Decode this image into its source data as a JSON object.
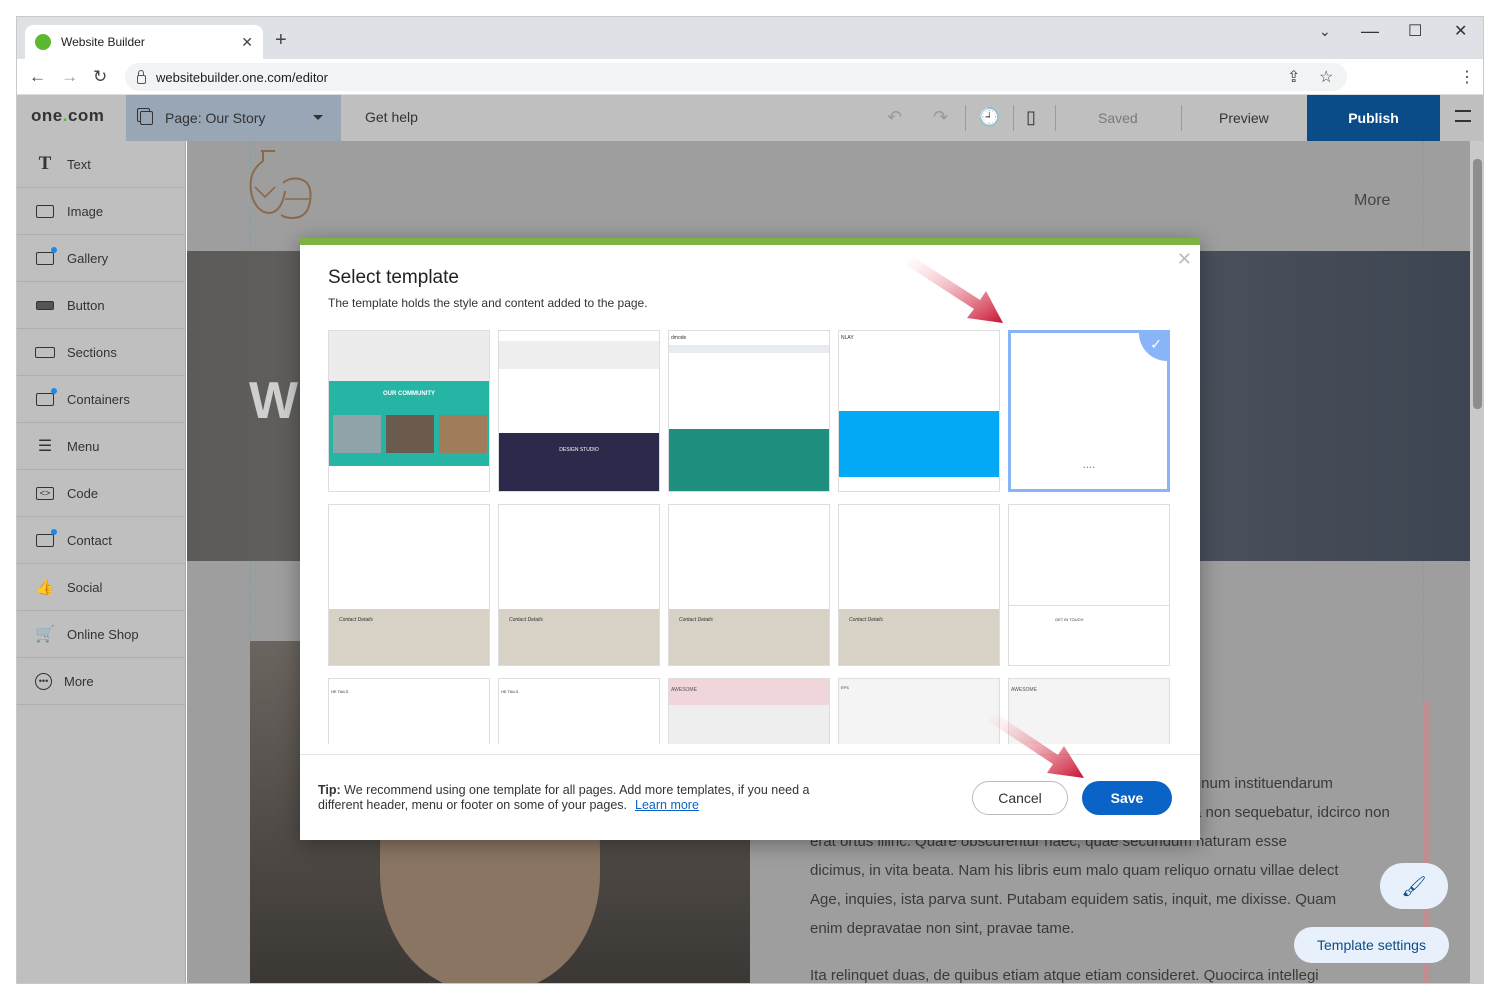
{
  "browser": {
    "tab_title": "Website Builder",
    "url": "websitebuilder.one.com/editor"
  },
  "toolbar": {
    "logo_prefix": "one",
    "logo_dot": ".",
    "logo_suffix": "com",
    "page_label": "Page:",
    "page_name": "Our Story",
    "get_help": "Get help",
    "saved": "Saved",
    "preview": "Preview",
    "publish": "Publish"
  },
  "sidebar": {
    "items": [
      {
        "label": "Text",
        "icon": "text-icon"
      },
      {
        "label": "Image",
        "icon": "image-icon"
      },
      {
        "label": "Gallery",
        "icon": "gallery-icon"
      },
      {
        "label": "Button",
        "icon": "button-icon"
      },
      {
        "label": "Sections",
        "icon": "sections-icon"
      },
      {
        "label": "Containers",
        "icon": "containers-icon"
      },
      {
        "label": "Menu",
        "icon": "menu-icon"
      },
      {
        "label": "Code",
        "icon": "code-icon"
      },
      {
        "label": "Contact",
        "icon": "contact-icon"
      },
      {
        "label": "Social",
        "icon": "thumbs-up-icon"
      },
      {
        "label": "Online Shop",
        "icon": "cart-icon"
      },
      {
        "label": "More",
        "icon": "more-icon"
      }
    ]
  },
  "canvas": {
    "nav_more": "More",
    "hero_letter": "W",
    "body_lines": [
      "tudinum instituendarum",
      "a non sequebatur, idcirco non",
      "erat ortus illinc. Quare obscurentur haec, quae secundum naturam esse",
      "dicimus, in vita beata. Nam his libris eum malo quam reliquo ornatu villae delect",
      "Age, inquies, ista parva sunt. Putabam equidem satis, inquit, me dixisse. Quam",
      "enim depravatae non sint, pravae tame.",
      "Ita relinquet duas, de quibus etiam atque etiam consideret. Quocirca intellegi"
    ],
    "template_settings": "Template settings"
  },
  "modal": {
    "title": "Select template",
    "subtitle": "The template holds the style and content added to the page.",
    "templates": [
      {
        "caption": "OUR COMMUNITY"
      },
      {
        "caption": "DESIGN STUDIO"
      },
      {
        "caption": "dmode"
      },
      {
        "caption": "NLAY"
      },
      {
        "caption": ""
      },
      {
        "caption": "Contact Details"
      },
      {
        "caption": "Contact Details"
      },
      {
        "caption": "Contact Details"
      },
      {
        "caption": "Contact Details"
      },
      {
        "caption": "GET IN TOUCH"
      },
      {
        "caption": "HE TAILS"
      },
      {
        "caption": "HE TAILS"
      },
      {
        "caption": "AWESOME"
      },
      {
        "caption": "EFS"
      },
      {
        "caption": "AWESOME"
      }
    ],
    "selected_index": 4,
    "tip_label": "Tip:",
    "tip_text": "We recommend using one template for all pages. Add more templates, if you need a different header, menu or footer on some of your pages.",
    "learn_more": "Learn more",
    "cancel": "Cancel",
    "save": "Save"
  },
  "colors": {
    "publish": "#0a4c87",
    "modal_accent": "#7cb342",
    "save_button": "#0a64c8",
    "annotation_arrow": "#d3192c"
  }
}
